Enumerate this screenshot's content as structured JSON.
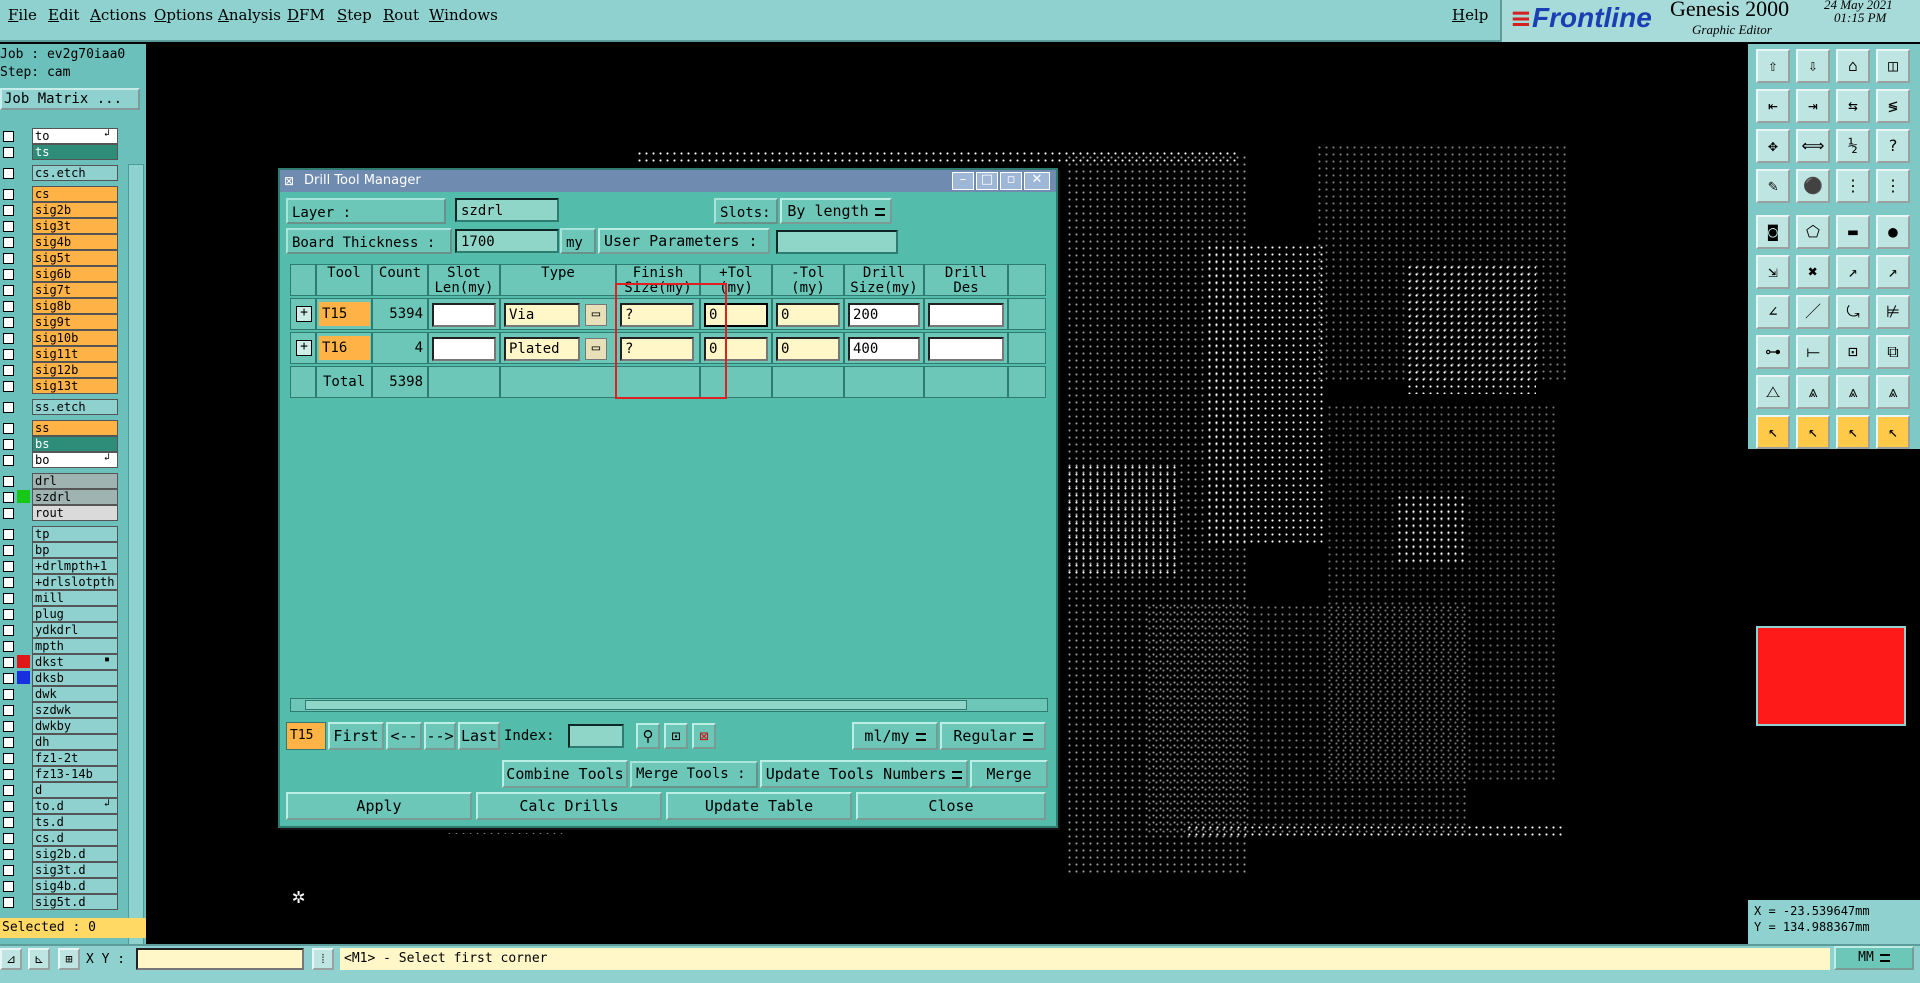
{
  "menu": {
    "items": [
      "File",
      "Edit",
      "Actions",
      "Options",
      "Analysis",
      "DFM",
      "Step",
      "Rout",
      "Windows"
    ],
    "help": "Help"
  },
  "brand": {
    "logo": "Frontline",
    "product": "Genesis 2000",
    "subtitle": "Graphic Editor",
    "date": "24 May 2021",
    "time": "01:15 PM"
  },
  "job": {
    "job_label": "Job : ev2g70iaa0",
    "step_label": "Step: cam",
    "matrix_button": "Job Matrix ..."
  },
  "layers": [
    {
      "name": "to",
      "bg": "#ffffff",
      "mark": "↲"
    },
    {
      "name": "ts",
      "bg": "#2e8d79"
    },
    {
      "name": "cs.etch",
      "bg": "#8fd1cf",
      "gap": true
    },
    {
      "name": "cs",
      "bg": "#ffb347",
      "gap": true
    },
    {
      "name": "sig2b",
      "bg": "#ffb347"
    },
    {
      "name": "sig3t",
      "bg": "#ffb347"
    },
    {
      "name": "sig4b",
      "bg": "#ffb347"
    },
    {
      "name": "sig5t",
      "bg": "#ffb347"
    },
    {
      "name": "sig6b",
      "bg": "#ffb347"
    },
    {
      "name": "sig7t",
      "bg": "#ffb347"
    },
    {
      "name": "sig8b",
      "bg": "#ffb347"
    },
    {
      "name": "sig9t",
      "bg": "#ffb347"
    },
    {
      "name": "sig10b",
      "bg": "#ffb347"
    },
    {
      "name": "sig11t",
      "bg": "#ffb347"
    },
    {
      "name": "sig12b",
      "bg": "#ffb347"
    },
    {
      "name": "sig13t",
      "bg": "#ffb347"
    },
    {
      "name": "ss.etch",
      "bg": "#8fd1cf",
      "gap": true
    },
    {
      "name": "ss",
      "bg": "#ffb347",
      "gap": true
    },
    {
      "name": "bs",
      "bg": "#2e8d79"
    },
    {
      "name": "bo",
      "bg": "#ffffff",
      "mark": "↲"
    },
    {
      "name": "drl",
      "bg": "#9fb3b1",
      "gap": true
    },
    {
      "name": "szdrl",
      "bg": "#9fb3b1",
      "color": "#18c818"
    },
    {
      "name": "rout",
      "bg": "#dadada"
    },
    {
      "name": "tp",
      "bg": "#8fd1cf",
      "gap": true
    },
    {
      "name": "bp",
      "bg": "#8fd1cf"
    },
    {
      "name": "+drlmpth+1",
      "bg": "#8fd1cf"
    },
    {
      "name": "+drlslotpth",
      "bg": "#8fd1cf"
    },
    {
      "name": "mill",
      "bg": "#8fd1cf"
    },
    {
      "name": "plug",
      "bg": "#8fd1cf"
    },
    {
      "name": "ydkdrl",
      "bg": "#8fd1cf"
    },
    {
      "name": "mpth",
      "bg": "#8fd1cf"
    },
    {
      "name": "dkst",
      "bg": "#8fd1cf",
      "color": "#e01818",
      "mark": "▪"
    },
    {
      "name": "dksb",
      "bg": "#8fd1cf",
      "color": "#1830e0"
    },
    {
      "name": "dwk",
      "bg": "#8fd1cf"
    },
    {
      "name": "szdwk",
      "bg": "#8fd1cf"
    },
    {
      "name": "dwkby",
      "bg": "#8fd1cf"
    },
    {
      "name": "dh",
      "bg": "#8fd1cf"
    },
    {
      "name": "fz1-2t",
      "bg": "#8fd1cf"
    },
    {
      "name": "fz13-14b",
      "bg": "#8fd1cf"
    },
    {
      "name": "d",
      "bg": "#8fd1cf"
    },
    {
      "name": "to.d",
      "bg": "#8fd1cf",
      "mark": "↲"
    },
    {
      "name": "ts.d",
      "bg": "#8fd1cf"
    },
    {
      "name": "cs.d",
      "bg": "#8fd1cf"
    },
    {
      "name": "sig2b.d",
      "bg": "#8fd1cf"
    },
    {
      "name": "sig3t.d",
      "bg": "#8fd1cf"
    },
    {
      "name": "sig4b.d",
      "bg": "#8fd1cf"
    },
    {
      "name": "sig5t.d",
      "bg": "#8fd1cf"
    }
  ],
  "selected": "Selected : 0",
  "dialog": {
    "title": "Drill Tool Manager",
    "layer_label": "Layer          :",
    "layer_value": "szdrl",
    "slots_label": "Slots:",
    "slots_value": "By length",
    "thickness_label": "Board Thickness :",
    "thickness_value": "1700",
    "thickness_unit": "my",
    "user_params_label": "User Parameters :",
    "columns": [
      {
        "l1": "",
        "l2": ""
      },
      {
        "l1": "Tool",
        "l2": ""
      },
      {
        "l1": "Count",
        "l2": ""
      },
      {
        "l1": "Slot",
        "l2": "Len(my)"
      },
      {
        "l1": "Type",
        "l2": ""
      },
      {
        "l1": "Finish",
        "l2": "Size(my)"
      },
      {
        "l1": "+Tol",
        "l2": "(my)"
      },
      {
        "l1": "-Tol",
        "l2": "(my)"
      },
      {
        "l1": "Drill",
        "l2": "Size(my)"
      },
      {
        "l1": "Drill",
        "l2": "Des"
      }
    ],
    "rows": [
      {
        "tool": "T15",
        "count": "5394",
        "slot": "",
        "type": "Via",
        "finish": "?",
        "ptol": "0",
        "mtol": "0",
        "drill": "200",
        "des": ""
      },
      {
        "tool": "T16",
        "count": "4",
        "slot": "",
        "type": "Plated",
        "finish": "?",
        "ptol": "0",
        "mtol": "0",
        "drill": "400",
        "des": ""
      }
    ],
    "total": {
      "label": "Total",
      "count": "5398"
    },
    "nav": {
      "current": "T15",
      "first": "First",
      "prev": "<--",
      "next": "-->",
      "last": "Last",
      "index_label": "Index:",
      "units": "ml/my",
      "mode": "Regular"
    },
    "actions": {
      "combine": "Combine Tools",
      "merge_label": "Merge Tools :",
      "merge_value": "Update Tools Numbers",
      "merge": "Merge"
    },
    "footer": {
      "apply": "Apply",
      "calc": "Calc Drills",
      "update": "Update Table",
      "close": "Close"
    }
  },
  "coords": {
    "x": "X = -23.539647mm",
    "y": "Y = 134.988367mm"
  },
  "status": {
    "xy_label": "X Y :",
    "prompt": "<M1> - Select first corner",
    "units": "MM"
  }
}
